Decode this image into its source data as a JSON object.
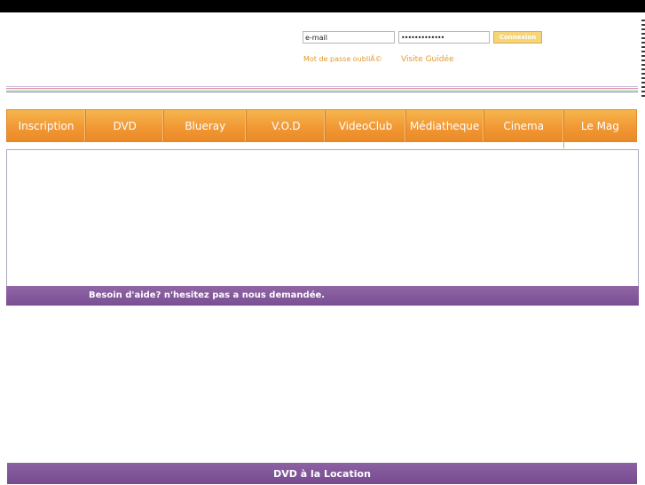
{
  "login": {
    "email_value": "e-mail",
    "password_value": "•••••••••••••",
    "connect_label": "Connexion",
    "forgot_label": "Mot de passe oubliÃ©",
    "tour_label": "Visite Guidée"
  },
  "nav": {
    "items": [
      "Inscription",
      "DVD",
      "Blueray",
      "V.O.D",
      "VideoClub",
      "Médiatheque",
      "Cinema",
      "Le Mag"
    ]
  },
  "help": {
    "text": "Besoin d'aide? n'hesitez pas a nous demandée."
  },
  "footer": {
    "text": "DVD à la Location"
  },
  "colors": {
    "nav_orange": "#f19834",
    "bar_purple": "#7a4e94",
    "link_orange": "#e29a2c",
    "divider_lines": [
      "#c8b5d7",
      "#d98fae",
      "#a8d9a3",
      "#7a7fa6"
    ]
  }
}
